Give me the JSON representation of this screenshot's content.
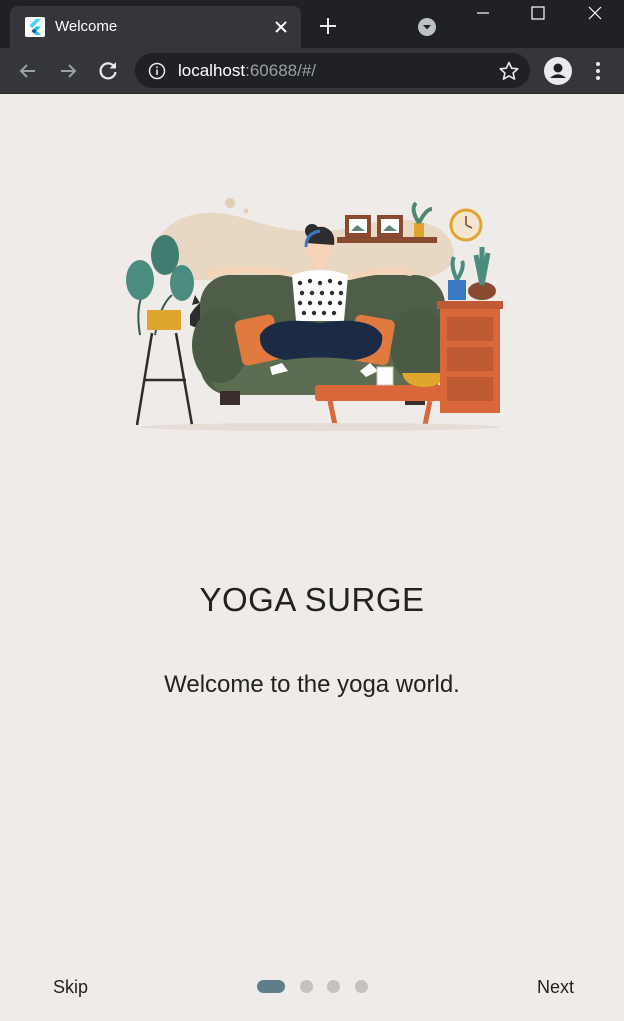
{
  "browser": {
    "tab": {
      "title": "Welcome",
      "favicon": "flutter-logo-icon"
    },
    "address": {
      "host": "localhost",
      "rest": ":60688/#/"
    }
  },
  "onboarding": {
    "illustration": "yoga-woman-on-couch-illustration",
    "title": "YOGA SURGE",
    "subtitle": "Welcome to the yoga world.",
    "skip_label": "Skip",
    "next_label": "Next",
    "page_indicator": {
      "pages": 4,
      "current": 1
    }
  },
  "colors": {
    "background": "#efebe8",
    "indicator_active": "#607d8b",
    "indicator_inactive": "#c4c1bf",
    "chrome_dark": "#202124",
    "chrome_mid": "#35363a"
  }
}
